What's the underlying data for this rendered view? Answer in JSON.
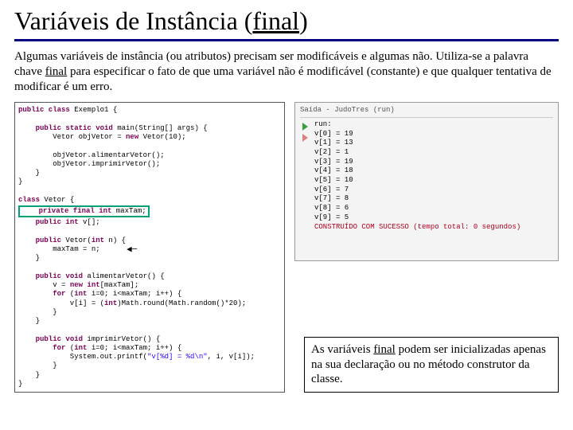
{
  "title_pre": "Variáveis de Instância (",
  "title_u": "final",
  "title_post": ")",
  "intro_a": "Algumas variáveis de instância (ou atributos) precisam ser modificáveis e algumas não. Utiliza-se a palavra chave ",
  "intro_u": "final",
  "intro_b": " para especificar o fato de que uma variável não é modificável (constante) e que qualquer tentativa de modificar é um erro.",
  "code": {
    "l1a": "public",
    "l1b": " class",
    "l1c": " Exemplo1 {",
    "l2a": "public",
    "l2b": " static",
    "l2c": " void",
    "l2d": " main(String[] args) {",
    "l3a": "        Vetor objVetor = ",
    "l3b": "new",
    "l3c": " Vetor(10);",
    "l4": "        objVetor.alimentarVetor();",
    "l5": "        objVetor.imprimirVetor();",
    "l6": "    }",
    "l7": "}",
    "l8a": "class",
    "l8b": " Vetor {",
    "l9a": "private",
    "l9b": " final",
    "l9c": " int",
    "l9d": " maxTam;",
    "l10a": "public",
    "l10b": " int",
    "l10c": " v[];",
    "l11a": "public",
    "l11b": " Vetor(",
    "l11c": "int",
    "l11d": " n) {",
    "l12": "        maxTam = n;",
    "l13": "    }",
    "l14a": "public",
    "l14b": " void",
    "l14c": " alimentarVetor() {",
    "l15a": "        v = ",
    "l15b": "new",
    "l15c": " int",
    "l15d": "[maxTam];",
    "l16a": "for",
    "l16b": " (",
    "l16c": "int",
    "l16d": " i=0; i<maxTam; i++) {",
    "l17a": "            v[i] = (",
    "l17b": "int",
    "l17c": ")Math.round(Math.random()*20);",
    "l18": "        }",
    "l19": "    }",
    "l20a": "public",
    "l20b": " void",
    "l20c": " imprimirVetor() {",
    "l21a": "for",
    "l21b": " (",
    "l21c": "int",
    "l21d": " i=0; i<maxTam; i++) {",
    "l22a": "            System.out.printf(",
    "l22b": "\"v[%d] = %d\\n\"",
    "l22c": ", i, v[i]);",
    "l23": "        }",
    "l24": "    }",
    "l25": "}"
  },
  "console": {
    "header": "Saída - JudoTres (run)",
    "lbl_run": "run:",
    "r0": "v[0] = 19",
    "r1": "v[1] = 13",
    "r2": "v[2] = 1",
    "r3": "v[3] = 19",
    "r4": "v[4] = 18",
    "r5": "v[5] = 10",
    "r6": "v[6] = 7",
    "r7": "v[7] = 8",
    "r8": "v[8] = 6",
    "r9": "v[9] = 5",
    "exit": "CONSTRUÍDO COM SUCESSO (tempo total: 0 segundos)"
  },
  "note_a": "As variáveis ",
  "note_u": "final",
  "note_b": " podem ser inicializadas apenas na sua declaração ou no método construtor da classe."
}
